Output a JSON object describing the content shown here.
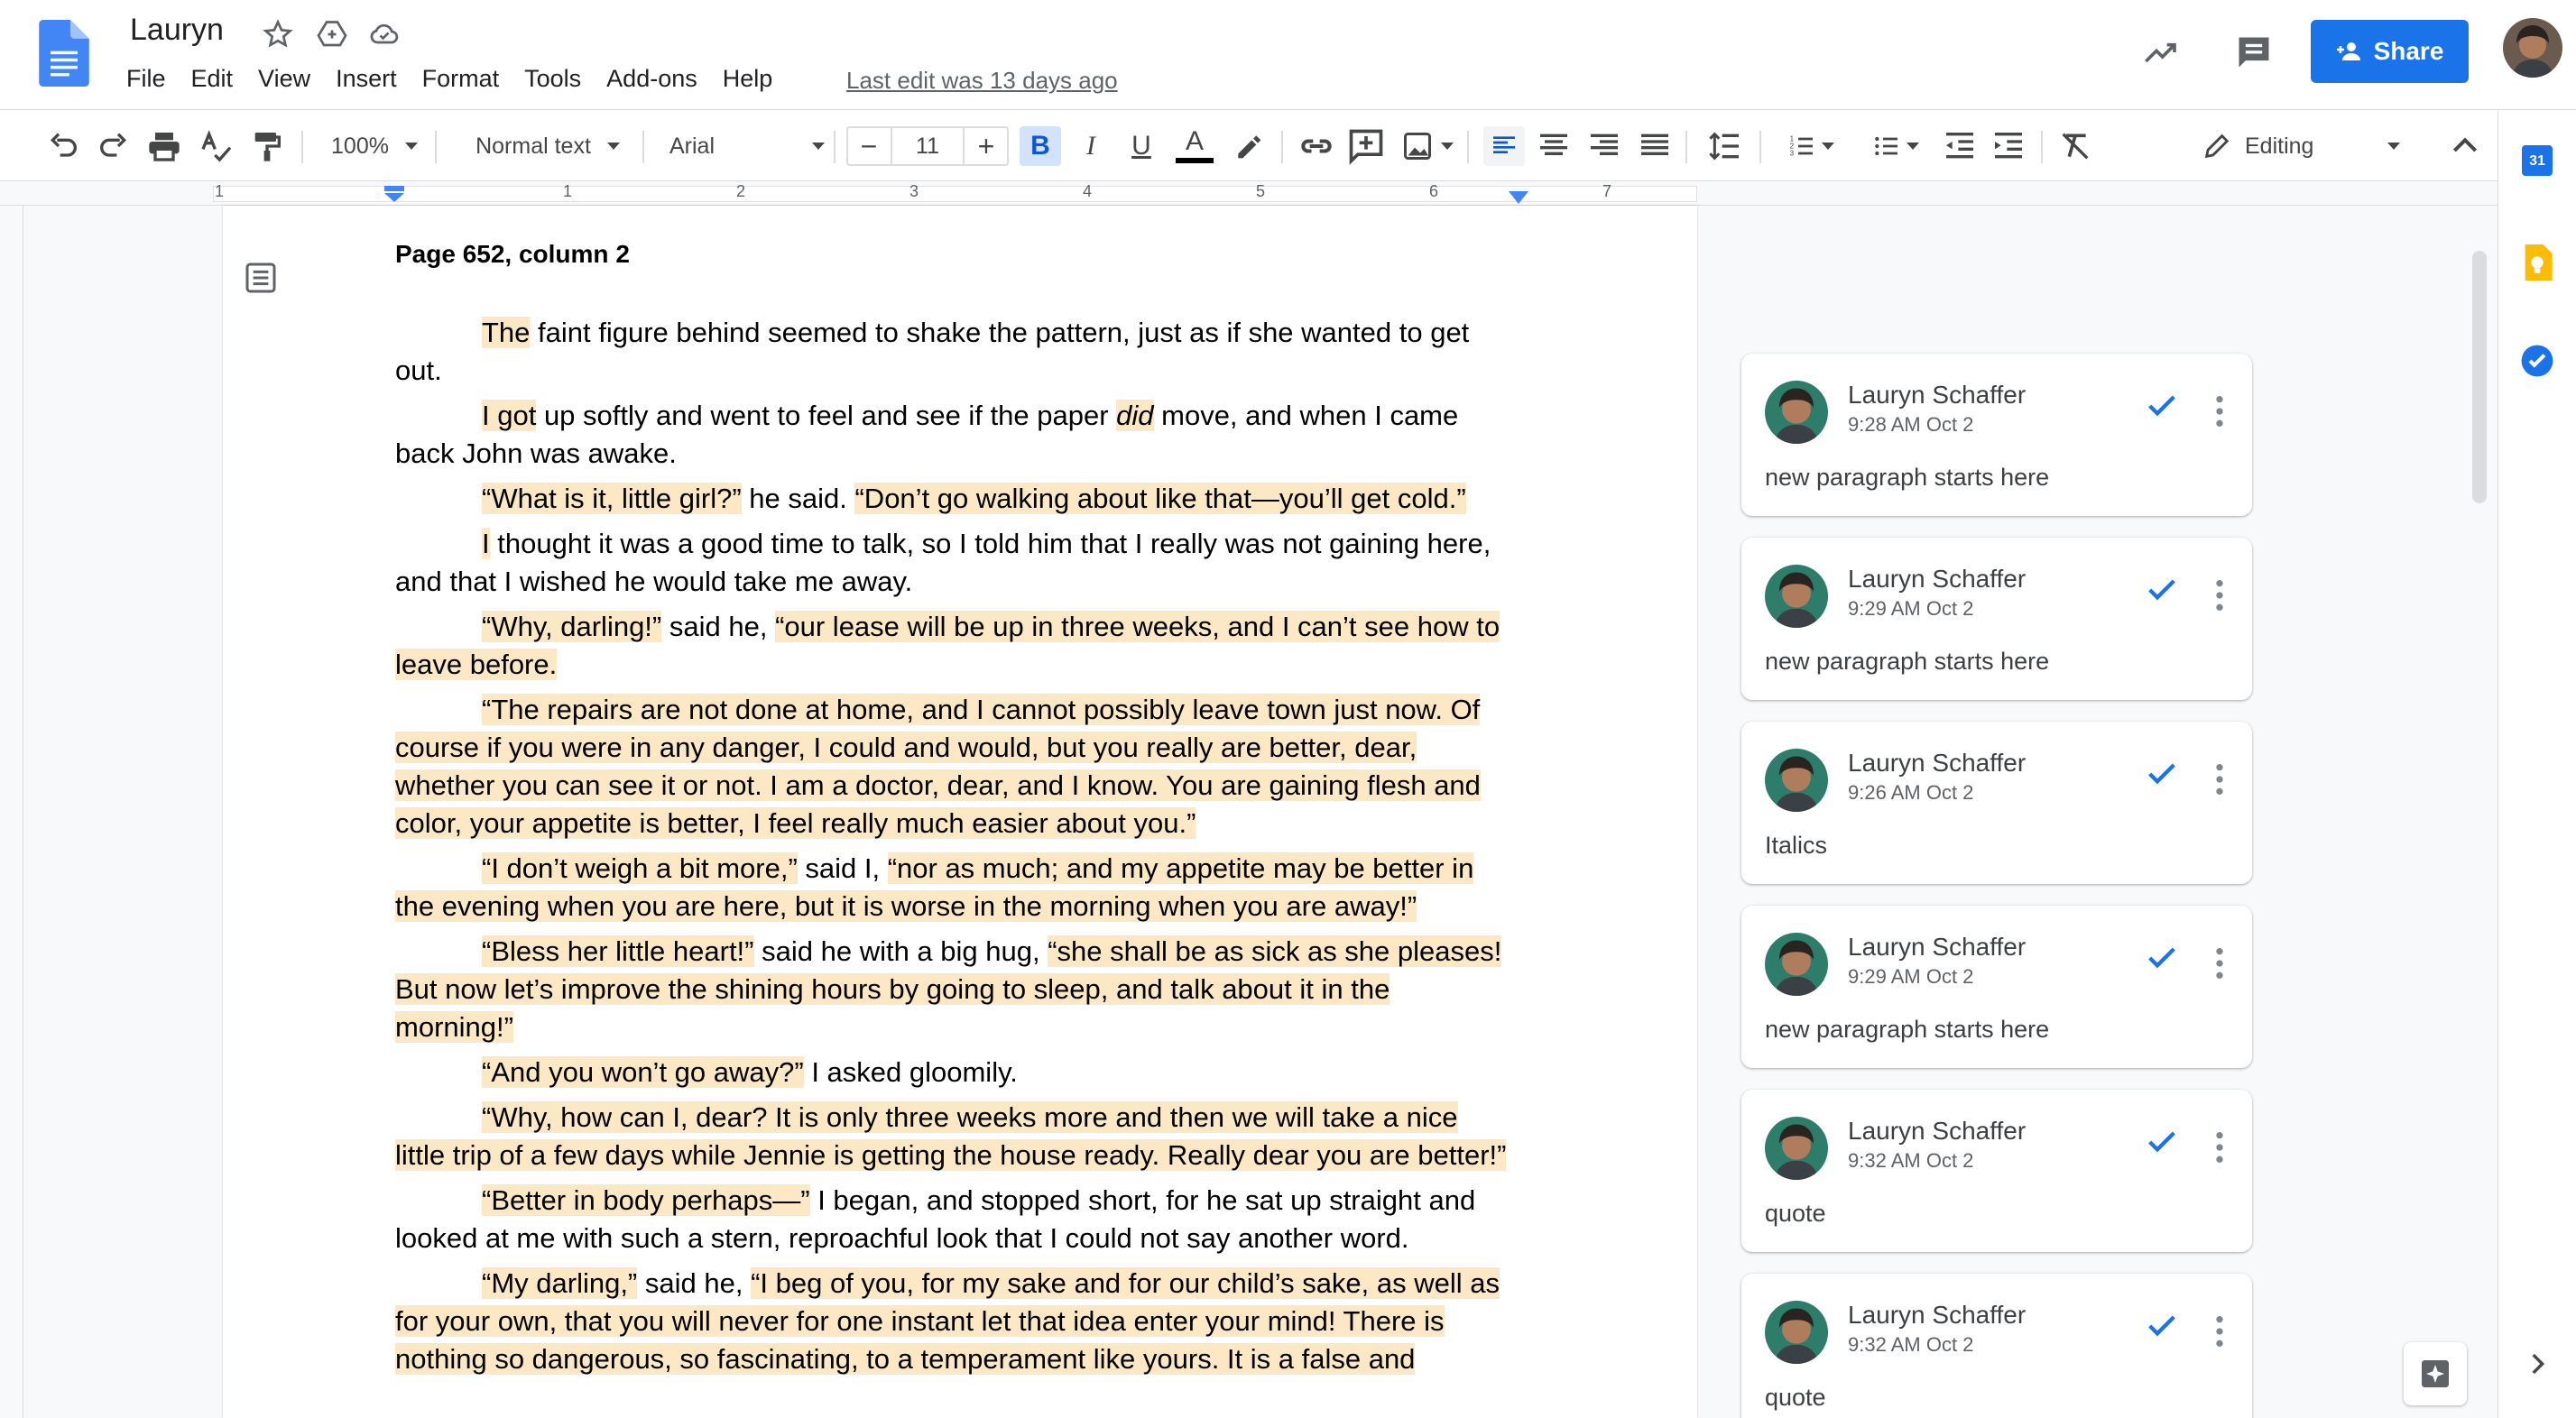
{
  "app": {
    "doc_title": "Lauryn",
    "last_edit": "Last edit was 13 days ago",
    "share_label": "Share",
    "menu": [
      "File",
      "Edit",
      "View",
      "Insert",
      "Format",
      "Tools",
      "Add-ons",
      "Help"
    ]
  },
  "toolbar": {
    "zoom": "100%",
    "style": "Normal text",
    "font": "Arial",
    "font_size": "11",
    "mode": "Editing"
  },
  "ruler": {
    "labels": [
      "1",
      "1",
      "2",
      "3",
      "4",
      "5",
      "6",
      "7"
    ]
  },
  "document": {
    "heading": "Page 652, column 2",
    "paragraphs": [
      [
        {
          "t": "The",
          "h": true
        },
        {
          "t": " faint figure behind seemed to shake the pattern, just as if she wanted to get out."
        }
      ],
      [
        {
          "t": "I got",
          "h": true
        },
        {
          "t": " up softly and went to feel and see if the paper "
        },
        {
          "t": "did",
          "h": true,
          "i": true
        },
        {
          "t": " move, and when I came back John was awake."
        }
      ],
      [
        {
          "t": "“What is it, little girl?”",
          "h": true
        },
        {
          "t": " he said. "
        },
        {
          "t": "“Don’t go walking about like that—you’ll get cold.”",
          "h": true
        }
      ],
      [
        {
          "t": "I",
          "h": true
        },
        {
          "t": " thought it was a good time to talk, so I told him that I really was not gaining here, and that I wished he would take me away."
        }
      ],
      [
        {
          "t": "“Why, darling!”",
          "h": true
        },
        {
          "t": " said he, "
        },
        {
          "t": "“our lease will be up in three weeks, and I can’t see how to leave before.",
          "h": true
        }
      ],
      [
        {
          "t": "“The repairs are not done at home, and I cannot possibly leave town just now. Of course if you were in any danger, I could and would, but you really are better, dear, whether you can see it or not. I am a doctor, dear, and I know. You are gaining flesh and color, your appetite is better, I feel really much easier about you.”",
          "h": true
        }
      ],
      [
        {
          "t": "“I don’t weigh a bit more,”",
          "h": true
        },
        {
          "t": " said I, "
        },
        {
          "t": "“nor as much; and my appetite may be better in the evening when you are here, but it is worse in the morning when you are away!”",
          "h": true
        }
      ],
      [
        {
          "t": "“Bless her little heart!”",
          "h": true
        },
        {
          "t": " said he with a big hug, "
        },
        {
          "t": "“she shall be as sick as she pleases! But now let’s improve the shining hours by going to sleep, and talk about it in the morning!”",
          "h": true
        }
      ],
      [
        {
          "t": "“And you won’t go away?”",
          "h": true
        },
        {
          "t": " I asked gloomily."
        }
      ],
      [
        {
          "t": "“Why, how can I, dear? It is only three weeks more and then we will take a nice little trip of a few days while Jennie is getting the house ready. Really dear you are better!”",
          "h": true
        }
      ],
      [
        {
          "t": "“Better in body perhaps—”",
          "h": true
        },
        {
          "t": " I began, and stopped short, for he sat up straight and looked at me with such a stern, reproachful look that I could not say another word."
        }
      ],
      [
        {
          "t": "“My darling,”",
          "h": true
        },
        {
          "t": " said he, "
        },
        {
          "t": "“I beg of you, for my sake and for our child’s sake, as well as for your own, that you will never for one instant let that idea enter your mind! There is nothing so dangerous, so fascinating, to a temperament like yours. It is a false and",
          "h": true
        }
      ]
    ]
  },
  "comments": [
    {
      "author": "Lauryn Schaffer",
      "time": "9:28 AM Oct 2",
      "text": "new paragraph starts here"
    },
    {
      "author": "Lauryn Schaffer",
      "time": "9:29 AM Oct 2",
      "text": "new paragraph starts here"
    },
    {
      "author": "Lauryn Schaffer",
      "time": "9:26 AM Oct 2",
      "text": "Italics"
    },
    {
      "author": "Lauryn Schaffer",
      "time": "9:29 AM Oct 2",
      "text": "new paragraph starts here"
    },
    {
      "author": "Lauryn Schaffer",
      "time": "9:32 AM Oct 2",
      "text": "quote"
    },
    {
      "author": "Lauryn Schaffer",
      "time": "9:32 AM Oct 2",
      "text": "quote"
    }
  ],
  "side_panel": {
    "calendar_day": "31"
  },
  "colors": {
    "accent": "#1a73e8",
    "highlight": "#fce8c4",
    "keep": "#fbbc04"
  }
}
